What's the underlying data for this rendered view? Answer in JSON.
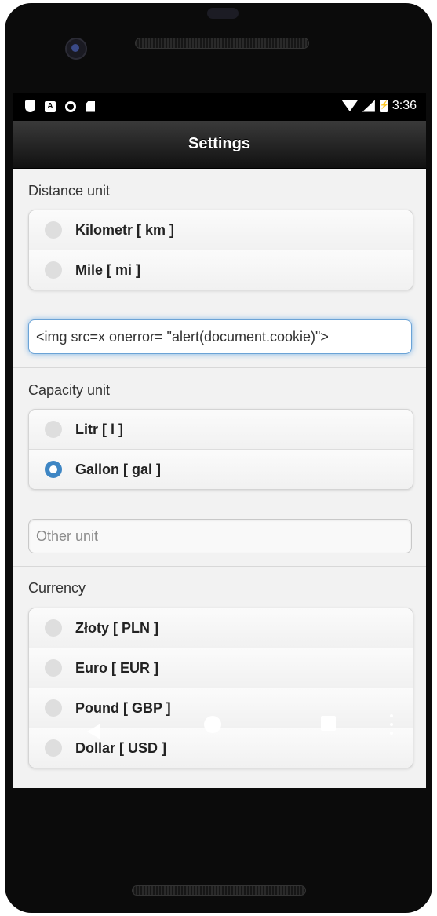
{
  "status_bar": {
    "time": "3:36",
    "left_icons": [
      "shield-icon",
      "a-notification-icon",
      "record-icon",
      "sd-card-icon"
    ],
    "right_icons": [
      "wifi-icon",
      "signal-icon",
      "battery-charging-icon"
    ]
  },
  "header": {
    "title": "Settings"
  },
  "distance": {
    "label": "Distance unit",
    "options": [
      {
        "label": "Kilometr [ km ]",
        "selected": false
      },
      {
        "label": "Mile [ mi ]",
        "selected": false
      }
    ],
    "custom_input_value": "<img src=x onerror= \"alert(document.cookie)\">"
  },
  "capacity": {
    "label": "Capacity unit",
    "options": [
      {
        "label": "Litr [ l ]",
        "selected": false
      },
      {
        "label": "Gallon [ gal ]",
        "selected": true
      }
    ],
    "custom_input_placeholder": "Other unit"
  },
  "currency": {
    "label": "Currency",
    "options": [
      {
        "label": "Złoty [ PLN ]",
        "selected": false
      },
      {
        "label": "Euro [ EUR ]",
        "selected": false
      },
      {
        "label": "Pound [ GBP ]",
        "selected": false
      },
      {
        "label": "Dollar [ USD ]",
        "selected": false
      }
    ]
  },
  "nav_bar": {
    "icons": [
      "back-icon",
      "home-icon",
      "recents-icon",
      "menu-icon"
    ]
  },
  "colors": {
    "accent": "#3e86c4",
    "header_bg": "#1f1f1f",
    "content_bg": "#f2f2f2"
  }
}
